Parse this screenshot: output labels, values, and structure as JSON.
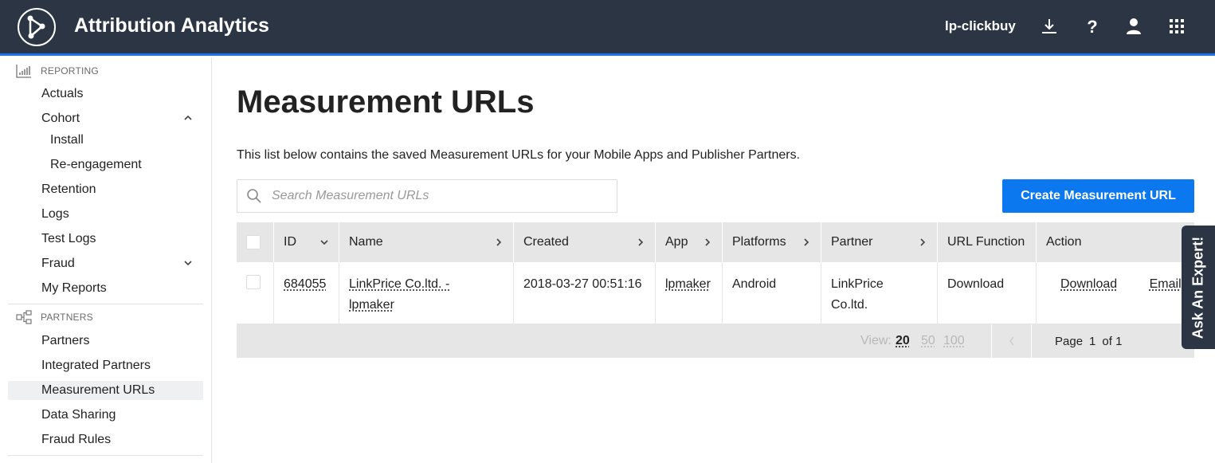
{
  "header": {
    "app_title": "Attribution Analytics",
    "account": "lp-clickbuy",
    "icons": [
      "download-icon",
      "help-icon",
      "user-icon",
      "apps-grid-icon"
    ]
  },
  "sidebar": {
    "reporting_label": "REPORTING",
    "reporting_items": [
      {
        "label": "Actuals"
      },
      {
        "label": "Cohort",
        "expanded": true
      },
      {
        "label": "Install"
      },
      {
        "label": "Re-engagement"
      },
      {
        "label": "Retention"
      },
      {
        "label": "Logs"
      },
      {
        "label": "Test Logs"
      },
      {
        "label": "Fraud",
        "expanded": false
      },
      {
        "label": "My Reports"
      }
    ],
    "partners_label": "PARTNERS",
    "partners_items": [
      {
        "label": "Partners"
      },
      {
        "label": "Integrated Partners"
      },
      {
        "label": "Measurement URLs",
        "active": true
      },
      {
        "label": "Data Sharing"
      },
      {
        "label": "Fraud Rules"
      }
    ]
  },
  "main": {
    "title": "Measurement URLs",
    "description": "This list below contains the saved Measurement URLs for your Mobile Apps and Publisher Partners.",
    "search_placeholder": "Search Measurement URLs",
    "create_button": "Create Measurement URL"
  },
  "table": {
    "columns": [
      "ID",
      "Name",
      "Created",
      "App",
      "Platforms",
      "Partner",
      "URL Function",
      "Action"
    ],
    "rows": [
      {
        "id": "684055",
        "name": "LinkPrice Co.ltd. - lpmaker",
        "created": "2018-03-27 00:51:16",
        "app": "lpmaker",
        "platforms": "Android",
        "partner": "LinkPrice Co.ltd.",
        "url_function": "Download",
        "actions": [
          "Download",
          "Email"
        ]
      }
    ],
    "footer": {
      "view_label": "View:",
      "page_sizes": [
        "20",
        "50",
        "100"
      ],
      "selected_page_size": "20",
      "page_label": "Page",
      "page": "1",
      "of_label": "of 1"
    }
  },
  "ask_expert": "Ask An Expert!",
  "colors": {
    "topbar": "#2b3544",
    "accent": "#0b78f0",
    "header_row": "#e6e6e6"
  }
}
